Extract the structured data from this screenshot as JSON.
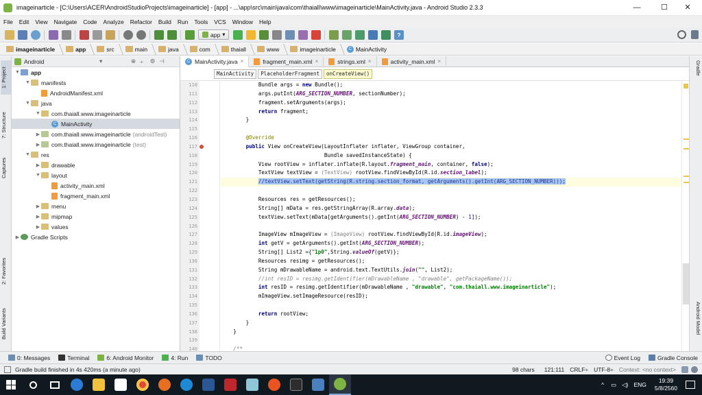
{
  "window": {
    "title": "imageinarticle - [C:\\Users\\ACER\\AndroidStudioProjects\\imageinarticle] - [app] - ...\\app\\src\\main\\java\\com\\thaiall\\www\\imageinarticle\\MainActivity.java - Android Studio 2.3.3",
    "minimize": "—",
    "maximize": "☐",
    "close": "✕"
  },
  "menu": [
    "File",
    "Edit",
    "View",
    "Navigate",
    "Code",
    "Analyze",
    "Refactor",
    "Build",
    "Run",
    "Tools",
    "VCS",
    "Window",
    "Help"
  ],
  "toolbar": {
    "run_config": "app",
    "icons": [
      "open-icon",
      "save-all-icon",
      "sync-icon",
      "undo-icon",
      "redo-icon",
      "cut-icon",
      "copy-icon",
      "paste-icon",
      "find-icon",
      "replace-icon",
      "back-icon",
      "forward-icon",
      "make-icon",
      "run-icon",
      "apply-changes-icon",
      "debug-icon",
      "attach-icon",
      "profile-icon",
      "coverage-icon",
      "stop-icon",
      "avd-icon",
      "sdk-icon",
      "sync-gradle-icon",
      "project-structure-icon",
      "device-monitor-icon",
      "help-icon"
    ]
  },
  "breadcrumb": [
    "imageinarticle",
    "app",
    "src",
    "main",
    "java",
    "com",
    "thaiall",
    "www",
    "imageinarticle",
    "MainActivity"
  ],
  "left_strip": {
    "project": "1: Project",
    "structure": "7: Structure",
    "captures": "Captures",
    "favorites": "2: Favorites",
    "build_variants": "Build Variants"
  },
  "right_strip": {
    "gradle": "Gradle",
    "android_model": "Android Model"
  },
  "project_panel": {
    "view_mode": "Android",
    "tree": [
      {
        "label": "app",
        "suffix": "",
        "indent": 0,
        "arrow": "▼",
        "icon": "folder-module"
      },
      {
        "label": "manifests",
        "suffix": "",
        "indent": 1,
        "arrow": "▼",
        "icon": "folder"
      },
      {
        "label": "AndroidManifest.xml",
        "suffix": "",
        "indent": 2,
        "arrow": "",
        "icon": "xml"
      },
      {
        "label": "java",
        "suffix": "",
        "indent": 1,
        "arrow": "▼",
        "icon": "folder"
      },
      {
        "label": "com.thaiall.www.imageinarticle",
        "suffix": "",
        "indent": 2,
        "arrow": "▼",
        "icon": "folder"
      },
      {
        "label": "MainActivity",
        "suffix": "",
        "indent": 3,
        "arrow": "",
        "icon": "class"
      },
      {
        "label": "com.thaiall.www.imageinarticle",
        "suffix": "(androidTest)",
        "indent": 2,
        "arrow": "▶",
        "icon": "folder-green"
      },
      {
        "label": "com.thaiall.www.imageinarticle",
        "suffix": "(test)",
        "indent": 2,
        "arrow": "▶",
        "icon": "folder-green"
      },
      {
        "label": "res",
        "suffix": "",
        "indent": 1,
        "arrow": "▼",
        "icon": "folder"
      },
      {
        "label": "drawable",
        "suffix": "",
        "indent": 2,
        "arrow": "▶",
        "icon": "folder"
      },
      {
        "label": "layout",
        "suffix": "",
        "indent": 2,
        "arrow": "▼",
        "icon": "folder"
      },
      {
        "label": "activity_main.xml",
        "suffix": "",
        "indent": 3,
        "arrow": "",
        "icon": "xml"
      },
      {
        "label": "fragment_main.xml",
        "suffix": "",
        "indent": 3,
        "arrow": "",
        "icon": "xml"
      },
      {
        "label": "menu",
        "suffix": "",
        "indent": 2,
        "arrow": "▶",
        "icon": "folder"
      },
      {
        "label": "mipmap",
        "suffix": "",
        "indent": 2,
        "arrow": "▶",
        "icon": "folder"
      },
      {
        "label": "values",
        "suffix": "",
        "indent": 2,
        "arrow": "▶",
        "icon": "folder"
      },
      {
        "label": "Gradle Scripts",
        "suffix": "",
        "indent": 0,
        "arrow": "▶",
        "icon": "gradle"
      }
    ]
  },
  "editor_tabs": [
    {
      "label": "MainActivity.java",
      "close": "×"
    },
    {
      "label": "fragment_main.xml",
      "close": "×"
    },
    {
      "label": "strings.xml",
      "close": "×"
    },
    {
      "label": "activity_main.xml",
      "close": "×"
    }
  ],
  "structure_crumbs": [
    "MainActivity",
    "PlaceholderFragment",
    "onCreateView()"
  ],
  "code": {
    "first_line": 110,
    "current_line": 121,
    "lines": [
      [
        [
          "",
          "            Bundle args = "
        ],
        [
          "kw",
          "new"
        ],
        [
          "",
          " Bundle();"
        ]
      ],
      [
        [
          "",
          "            args.putInt("
        ],
        [
          "fld",
          "ARG_SECTION_NUMBER"
        ],
        [
          "",
          ", sectionNumber);"
        ]
      ],
      [
        [
          "",
          "            fragment.setArguments(args);"
        ]
      ],
      [
        [
          "",
          "            "
        ],
        [
          "kw",
          "return"
        ],
        [
          "",
          " fragment;"
        ]
      ],
      [
        [
          "",
          "        }"
        ]
      ],
      [
        [
          "",
          ""
        ]
      ],
      [
        [
          "",
          "        "
        ],
        [
          "ann",
          "@Override"
        ]
      ],
      [
        [
          "",
          "        "
        ],
        [
          "kw",
          "public"
        ],
        [
          "",
          " View onCreateView(LayoutInflater inflater, ViewGroup container,"
        ]
      ],
      [
        [
          "",
          "                                 Bundle savedInstanceState) {"
        ]
      ],
      [
        [
          "",
          "            View rootView = inflater.inflate(R.layout."
        ],
        [
          "fld",
          "fragment_main"
        ],
        [
          "",
          ", container, "
        ],
        [
          "kw",
          "false"
        ],
        [
          "",
          ");"
        ]
      ],
      [
        [
          "",
          "            TextView textView = "
        ],
        [
          "gcast",
          "(TextView)"
        ],
        [
          "",
          " rootView.findViewById(R.id."
        ],
        [
          "fld",
          "section_label"
        ],
        [
          "",
          ");"
        ]
      ],
      [
        [
          "",
          "            "
        ],
        [
          "selbox",
          "//textView.setText(getString(R.string.section_format, getArguments().getInt(ARG_SECTION_NUMBER)));"
        ]
      ],
      [
        [
          "",
          ""
        ]
      ],
      [
        [
          "",
          "            Resources res = getResources();"
        ]
      ],
      [
        [
          "",
          "            String[] mData = res.getStringArray(R.array."
        ],
        [
          "fld",
          "data"
        ],
        [
          "",
          ");"
        ]
      ],
      [
        [
          "",
          "            textView.setText(mData[getArguments().getInt("
        ],
        [
          "fld",
          "ARG_SECTION_NUMBER"
        ],
        [
          "",
          ") - "
        ],
        [
          "num",
          "1"
        ],
        [
          "",
          "]);"
        ]
      ],
      [
        [
          "",
          ""
        ]
      ],
      [
        [
          "",
          "            ImageView mImageView = "
        ],
        [
          "gcast",
          "(ImageView)"
        ],
        [
          "",
          " rootView.findViewById(R.id."
        ],
        [
          "fld",
          "imageView"
        ],
        [
          "",
          ");"
        ]
      ],
      [
        [
          "",
          "            "
        ],
        [
          "kw",
          "int"
        ],
        [
          "",
          " getV = getArguments().getInt("
        ],
        [
          "fld",
          "ARG_SECTION_NUMBER"
        ],
        [
          "",
          ");"
        ]
      ],
      [
        [
          "",
          "            String[] List2 ={"
        ],
        [
          "str",
          "\"1p0\""
        ],
        [
          "",
          ",String."
        ],
        [
          "fld",
          "valueOf"
        ],
        [
          "",
          "(getV)};"
        ]
      ],
      [
        [
          "",
          "            Resources resimg = getResources();"
        ]
      ],
      [
        [
          "",
          "            String mDrawableName = android.text.TextUtils."
        ],
        [
          "fld",
          "join"
        ],
        [
          "",
          "("
        ],
        [
          "str",
          "\"\""
        ],
        [
          "",
          ", List2);"
        ]
      ],
      [
        [
          "",
          "            "
        ],
        [
          "cmt",
          "//int resID = resimg.getIdentifier(mDrawableName , \"drawable\", getPackageName());"
        ]
      ],
      [
        [
          "",
          "            "
        ],
        [
          "kw",
          "int"
        ],
        [
          "",
          " resID = resimg.getIdentifier(mDrawableName , "
        ],
        [
          "str",
          "\"drawable\""
        ],
        [
          "",
          ", "
        ],
        [
          "str",
          "\"com.thaiall.www.imageinarticle\""
        ],
        [
          "",
          ");"
        ]
      ],
      [
        [
          "",
          "            mImageView.setImageResource(resID);"
        ]
      ],
      [
        [
          "",
          ""
        ]
      ],
      [
        [
          "",
          "            "
        ],
        [
          "kw",
          "return"
        ],
        [
          "",
          " rootView;"
        ]
      ],
      [
        [
          "",
          "        }"
        ]
      ],
      [
        [
          "",
          "    }"
        ]
      ],
      [
        [
          "",
          ""
        ]
      ],
      [
        [
          "",
          "    "
        ],
        [
          "cmt",
          "/**"
        ]
      ]
    ]
  },
  "bottom_tabs": [
    {
      "label": "0: Messages"
    },
    {
      "label": "Terminal"
    },
    {
      "label": "6: Android Monitor"
    },
    {
      "label": "4: Run"
    },
    {
      "label": "TODO"
    }
  ],
  "bottom_right_tabs": [
    {
      "label": "Event Log"
    },
    {
      "label": "Gradle Console"
    }
  ],
  "status": {
    "message": "Gradle build finished in 4s 420ms (a minute ago)",
    "chars": "98 chars",
    "position": "121:111",
    "line_sep": "CRLF÷",
    "encoding": "UTF-8÷",
    "context": "Context: <no context>"
  },
  "taskbar": {
    "apps": [
      "start-icon",
      "search-icon",
      "task-view-icon",
      "edge-icon",
      "file-explorer-icon",
      "store-icon",
      "chrome-icon",
      "firefox-icon",
      "ie-icon",
      "word-icon",
      "ftp-icon",
      "notepad-icon",
      "ubuntu-icon",
      "terminal-icon",
      "virtualbox-icon",
      "android-studio-icon"
    ],
    "lang": "ENG",
    "time": "19:39",
    "date": "5/8/2560"
  },
  "colors": {
    "accent": "#a6c6f5",
    "android_green": "#7cb342"
  }
}
